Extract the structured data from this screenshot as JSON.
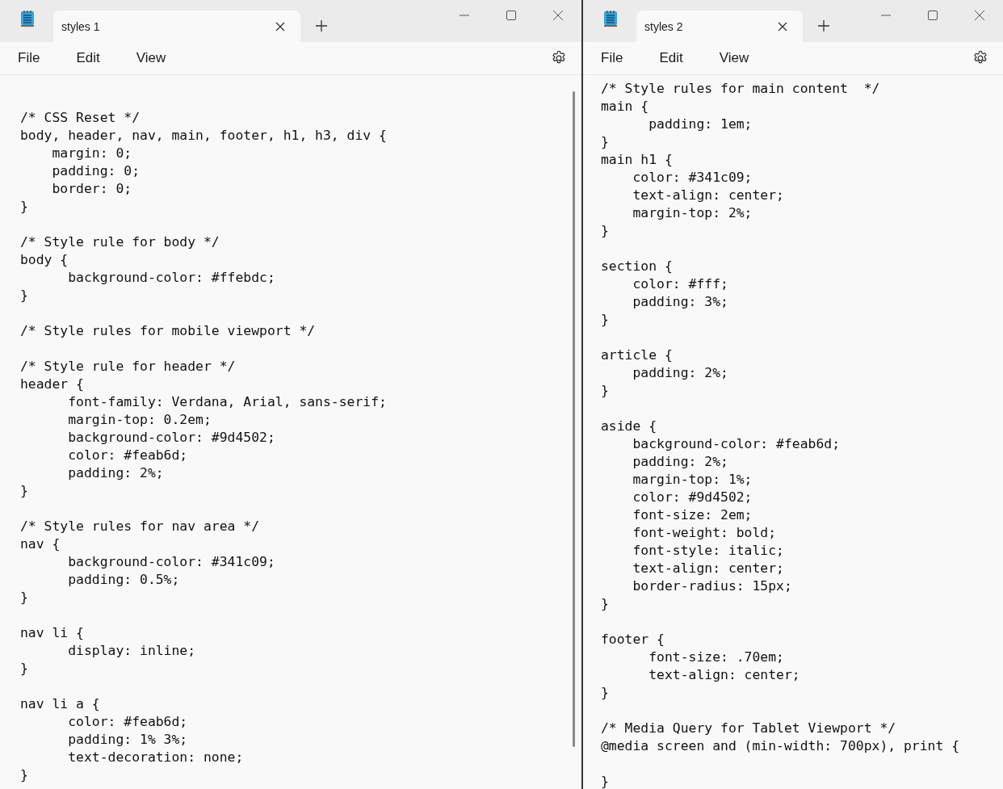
{
  "windows": [
    {
      "tab": {
        "title": "styles 1",
        "selected": true
      },
      "menu": [
        "File",
        "Edit",
        "View"
      ],
      "scrollbar": true,
      "code": "\n/* CSS Reset */\nbody, header, nav, main, footer, h1, h3, div {\n    margin: 0;\n    padding: 0;\n    border: 0;\n}\n\n/* Style rule for body */\nbody {\n      background-color: #ffebdc;\n}\n\n/* Style rules for mobile viewport */\n\n/* Style rule for header */\nheader {\n      font-family: Verdana, Arial, sans-serif;\n      margin-top: 0.2em;\n      background-color: #9d4502;\n      color: #feab6d;\n      padding: 2%;\n}\n\n/* Style rules for nav area */\nnav {\n      background-color: #341c09;\n      padding: 0.5%;\n}\n\nnav li {\n      display: inline;\n}\n\nnav li a {\n      color: #feab6d;\n      padding: 1% 3%;\n      text-decoration: none;\n}"
    },
    {
      "tab": {
        "title": "styles 2",
        "selected": true
      },
      "menu": [
        "File",
        "Edit",
        "View"
      ],
      "scrollbar": false,
      "code": "/* Style rules for main content  */\nmain {\n      padding: 1em;\n}\nmain h1 {\n    color: #341c09;\n    text-align: center;\n    margin-top: 2%;\n}\n\nsection {\n    color: #fff;\n    padding: 3%;\n}\n\narticle {\n    padding: 2%;\n}\n\naside {\n    background-color: #feab6d;\n    padding: 2%;\n    margin-top: 1%;\n    color: #9d4502;\n    font-size: 2em;\n    font-weight: bold;\n    font-style: italic;\n    text-align: center;\n    border-radius: 15px;\n}\n\nfooter {\n      font-size: .70em;\n      text-align: center;\n}\n\n/* Media Query for Tablet Viewport */\n@media screen and (min-width: 700px), print {\n\n}"
    }
  ]
}
